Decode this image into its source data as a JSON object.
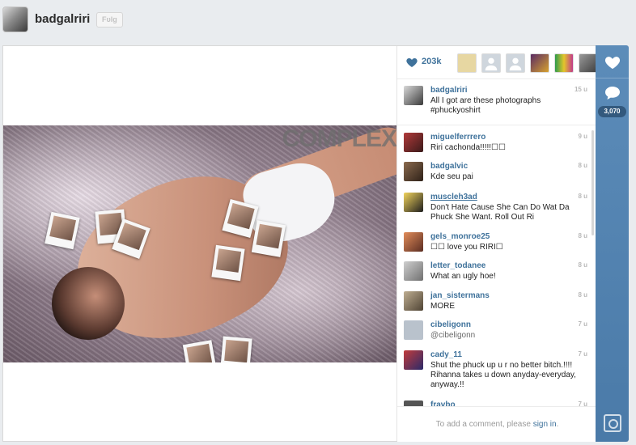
{
  "profile": {
    "username": "badgalriri",
    "follow_label": "Fυlg"
  },
  "photo": {
    "magazine_logo": "COMPLEX"
  },
  "likes": {
    "count": "203k",
    "likers": [
      {
        "name": "liker-1",
        "color": "#e7d7a2"
      },
      {
        "name": "liker-2",
        "color": "#cfd6dd"
      },
      {
        "name": "liker-3",
        "color": "#cfd6dd"
      },
      {
        "name": "liker-4",
        "color": "#5a2b64"
      },
      {
        "name": "liker-5",
        "color": "#2e9b4c"
      },
      {
        "name": "liker-6",
        "color": "#6b6b6b"
      }
    ]
  },
  "caption": {
    "user": "badgalriri",
    "time": "15 u",
    "text": "All I got are these photographs #phuckyoshirt"
  },
  "comments": [
    {
      "user": "miguelferrrero",
      "time": "9 u",
      "text": "Riri cachonda!!!!!☐☐"
    },
    {
      "user": "badgalvic",
      "time": "8 u",
      "text": "Kde seu pai"
    },
    {
      "user": "muscleh3ad",
      "time": "8 u",
      "text": "Don't Hate Cause She Can Do Wat Da Phuck She Want. Roll Out Ri"
    },
    {
      "user": "gels_monroe25",
      "time": "8 u",
      "text": "☐☐ love you RIRI☐"
    },
    {
      "user": "letter_todanee",
      "time": "8 u",
      "text": "What an ugly hoe!"
    },
    {
      "user": "jan_sistermans",
      "time": "8 u",
      "text": "MORE"
    },
    {
      "user": "cibeligonn",
      "time": "7 u",
      "text": "@cibeligonn"
    },
    {
      "user": "cady_11",
      "time": "7 u",
      "text": "Shut the phuck up u r no better bitch.!!!! Rihanna takes u down anyday-everyday, anyway.!!"
    },
    {
      "user": "fravbo",
      "time": "7 u",
      "text": ""
    }
  ],
  "add_comment": {
    "prefix": "To add a comment, please",
    "link": "sign in",
    "suffix": "."
  },
  "rail": {
    "comment_count": "3,070"
  },
  "colors": {
    "accent": "#3f729b",
    "rail": "#4a7aa8"
  }
}
